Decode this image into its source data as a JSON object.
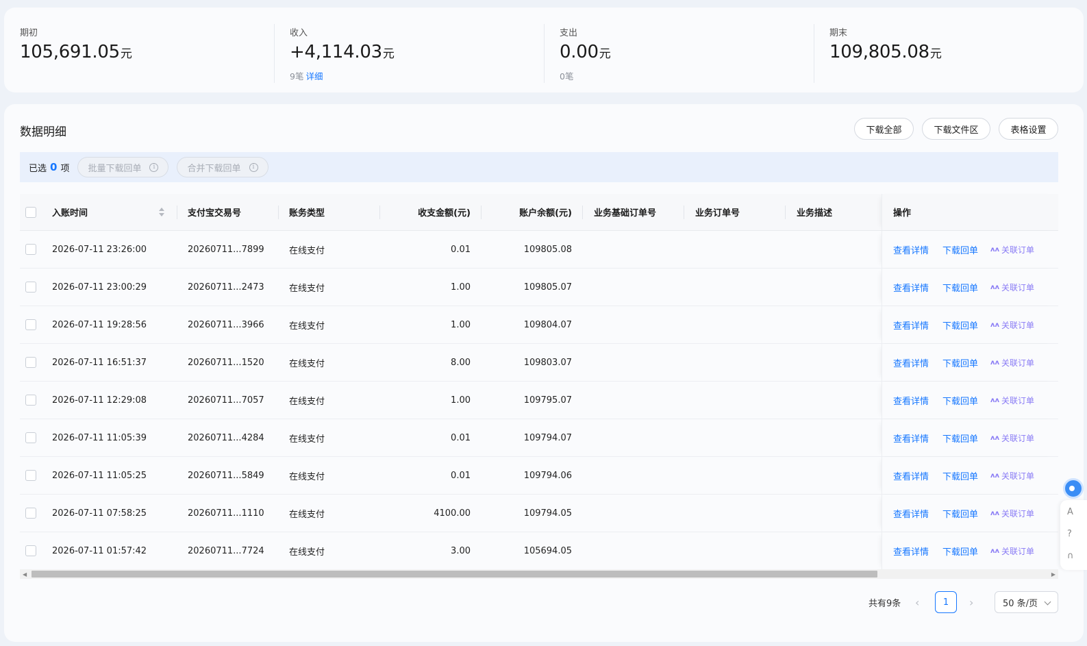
{
  "summary": [
    {
      "label": "期初",
      "amount": "105,691.05",
      "unit": "元",
      "sub_count": "",
      "sub_link": ""
    },
    {
      "label": "收入",
      "amount": "+4,114.03",
      "unit": "元",
      "sub_count": "9笔",
      "sub_link": "详细"
    },
    {
      "label": "支出",
      "amount": "0.00",
      "unit": "元",
      "sub_count": "0笔",
      "sub_link": ""
    },
    {
      "label": "期末",
      "amount": "109,805.08",
      "unit": "元",
      "sub_count": "",
      "sub_link": ""
    }
  ],
  "detail": {
    "title": "数据明细",
    "buttons": {
      "download_all": "下载全部",
      "download_area": "下载文件区",
      "table_settings": "表格设置"
    }
  },
  "selection": {
    "prefix": "已选",
    "count": "0",
    "suffix": "项",
    "batch_download": "批量下载回单",
    "merge_download": "合并下载回单"
  },
  "table": {
    "headers": {
      "time": "入账时间",
      "trade_no": "支付宝交易号",
      "type": "账务类型",
      "amount": "收支金额(元)",
      "balance": "账户余额(元)",
      "base_order": "业务基础订单号",
      "order": "业务订单号",
      "desc": "业务描述",
      "ops": "操作"
    },
    "rows": [
      {
        "time": "2026-07-11 23:26:00",
        "trade_no": "20260711...7899",
        "type": "在线支付",
        "amount": "0.01",
        "balance": "109805.08"
      },
      {
        "time": "2026-07-11 23:00:29",
        "trade_no": "20260711...2473",
        "type": "在线支付",
        "amount": "1.00",
        "balance": "109805.07"
      },
      {
        "time": "2026-07-11 19:28:56",
        "trade_no": "20260711...3966",
        "type": "在线支付",
        "amount": "1.00",
        "balance": "109804.07"
      },
      {
        "time": "2026-07-11 16:51:37",
        "trade_no": "20260711...1520",
        "type": "在线支付",
        "amount": "8.00",
        "balance": "109803.07"
      },
      {
        "time": "2026-07-11 12:29:08",
        "trade_no": "20260711...7057",
        "type": "在线支付",
        "amount": "1.00",
        "balance": "109795.07"
      },
      {
        "time": "2026-07-11 11:05:39",
        "trade_no": "20260711...4284",
        "type": "在线支付",
        "amount": "0.01",
        "balance": "109794.07"
      },
      {
        "time": "2026-07-11 11:05:25",
        "trade_no": "20260711...5849",
        "type": "在线支付",
        "amount": "0.01",
        "balance": "109794.06"
      },
      {
        "time": "2026-07-11 07:58:25",
        "trade_no": "20260711...1110",
        "type": "在线支付",
        "amount": "4100.00",
        "balance": "109794.05"
      },
      {
        "time": "2026-07-11 01:57:42",
        "trade_no": "20260711...7724",
        "type": "在线支付",
        "amount": "3.00",
        "balance": "105694.05"
      }
    ],
    "op_labels": {
      "view": "查看详情",
      "download": "下载回单",
      "link": "关联订单"
    }
  },
  "pagination": {
    "total": "共有9条",
    "current_page": "1",
    "page_size": "50 条/页"
  },
  "colors": {
    "accent": "#1677ff",
    "link_purple": "#8a7cf5"
  }
}
